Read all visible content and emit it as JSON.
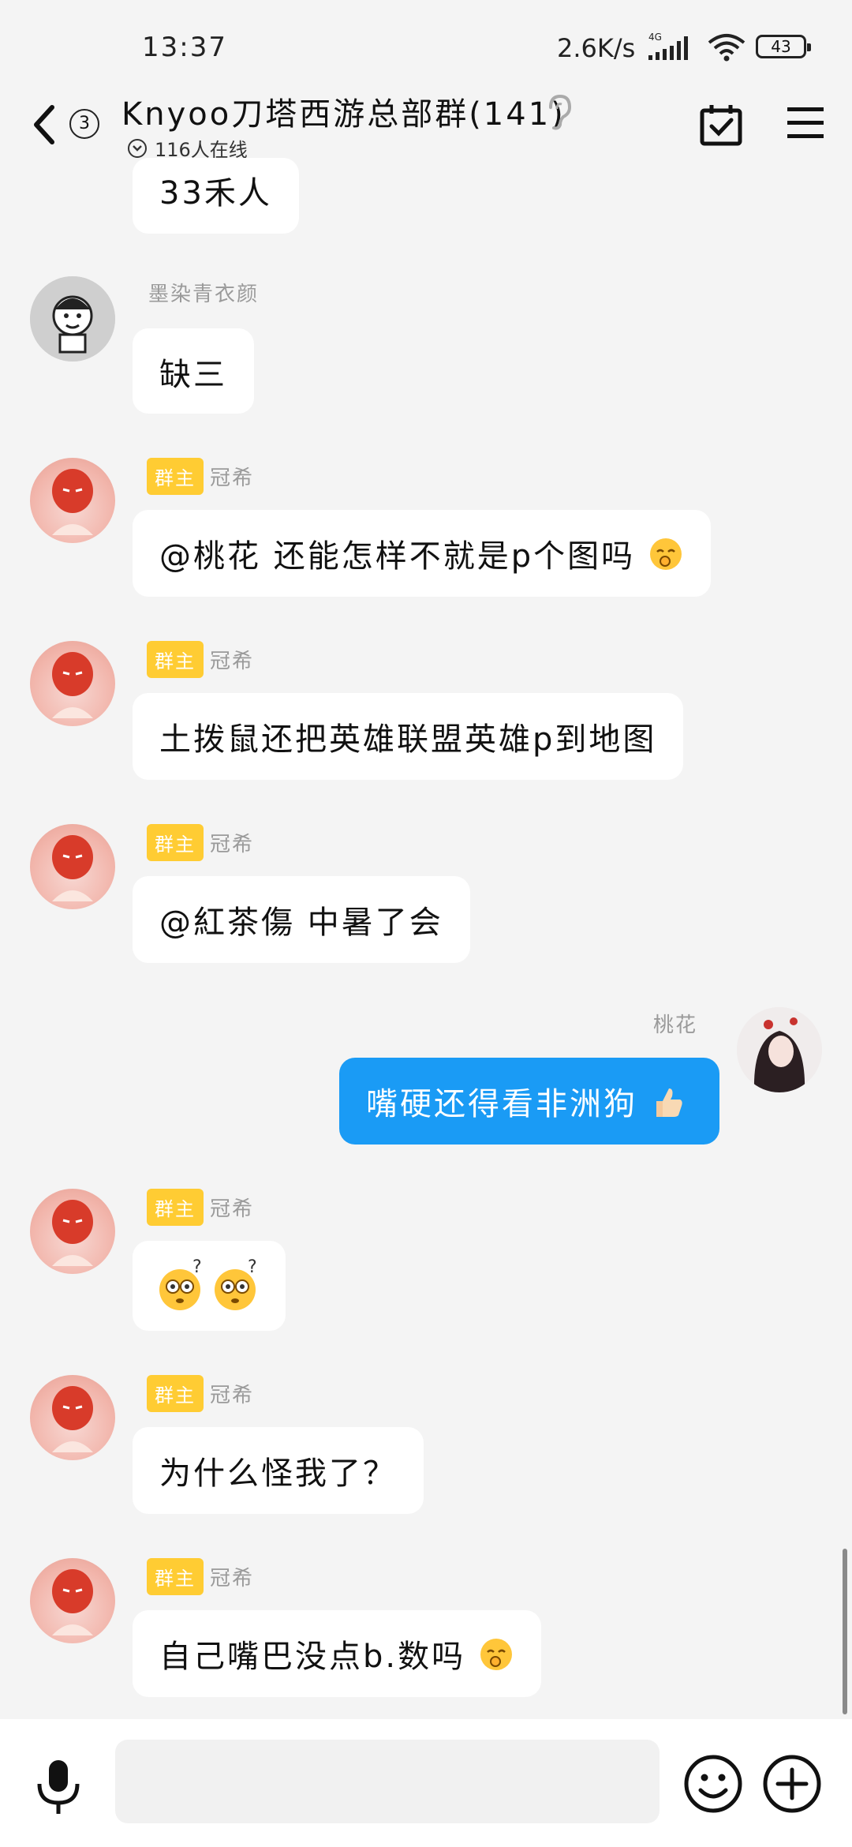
{
  "status_bar": {
    "time": "13:37",
    "net_speed": "2.6K/s",
    "network_type": "4G",
    "battery_level": "43"
  },
  "header": {
    "unread_count": "3",
    "title": "Knyoo刀塔西游总部群(141)",
    "online_text": "116人在线"
  },
  "messages": [
    {
      "sender": "",
      "badge": "",
      "text": "33禾人",
      "mine": false
    },
    {
      "sender": "墨染青衣颜",
      "badge": "",
      "text": "缺三",
      "mine": false
    },
    {
      "sender": "冠希",
      "badge": "群主",
      "text": "@桃花 还能怎样不就是p个图吗",
      "emoji": "shy-smile-emoji",
      "mine": false
    },
    {
      "sender": "冠希",
      "badge": "群主",
      "text": "土拨鼠还把英雄联盟英雄p到地图",
      "mine": false
    },
    {
      "sender": "冠希",
      "badge": "群主",
      "text": "@紅茶傷 中暑了会",
      "mine": false
    },
    {
      "sender": "桃花",
      "badge": "",
      "text": "嘴硬还得看非洲狗",
      "emoji": "thumbs-up-emoji",
      "mine": true
    },
    {
      "sender": "冠希",
      "badge": "群主",
      "text": "",
      "emoji": "confused-emoji",
      "mine": false
    },
    {
      "sender": "冠希",
      "badge": "群主",
      "text": "为什么怪我了？",
      "mine": false
    },
    {
      "sender": "冠希",
      "badge": "群主",
      "text": "自己嘴巴没点b.数吗",
      "emoji": "shy-smile-emoji",
      "mine": false
    }
  ],
  "colors": {
    "owner_badge": "#ffcc33",
    "my_bubble": "#1a9bf5",
    "background": "#f4f4f4"
  },
  "input_bar": {
    "placeholder": ""
  }
}
